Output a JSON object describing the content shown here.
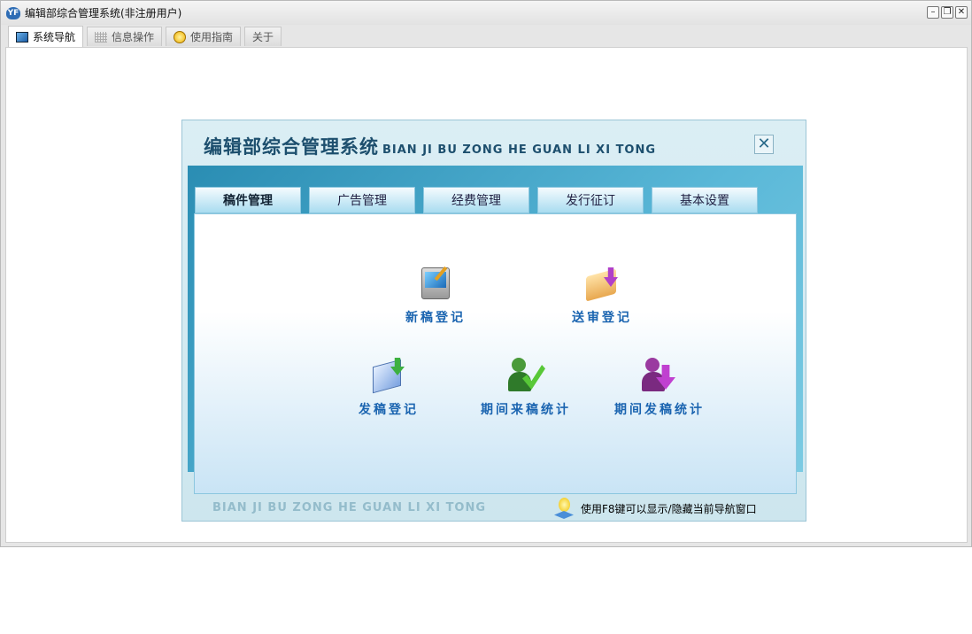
{
  "window": {
    "title": "编辑部综合管理系统(非注册用户)",
    "app_icon": "YF",
    "buttons": {
      "minimize": "–",
      "restore": "❐",
      "close": "✕"
    }
  },
  "tabs": [
    {
      "label": "系统导航",
      "icon": "monitor-icon"
    },
    {
      "label": "信息操作",
      "icon": "grid-icon"
    },
    {
      "label": "使用指南",
      "icon": "help-icon"
    },
    {
      "label": "关于"
    }
  ],
  "panel": {
    "title": "编辑部综合管理系统",
    "title_en": "BIAN JI BU ZONG HE GUAN LI XI TONG",
    "close": "✕",
    "tabs": [
      "稿件管理",
      "广告管理",
      "经费管理",
      "发行征订",
      "基本设置"
    ],
    "items": [
      {
        "label": "新稿登记",
        "icon": "computer-edit-icon"
      },
      {
        "label": "送审登记",
        "icon": "folder-down-icon"
      },
      {
        "label": "发稿登记",
        "icon": "document-down-icon"
      },
      {
        "label": "期间来稿统计",
        "icon": "user-check-icon"
      },
      {
        "label": "期间发稿统计",
        "icon": "user-arrow-icon"
      }
    ],
    "footer_en": "BIAN JI BU ZONG HE GUAN LI XI TONG",
    "hint": "使用F8键可以显示/隐藏当前导航窗口"
  }
}
